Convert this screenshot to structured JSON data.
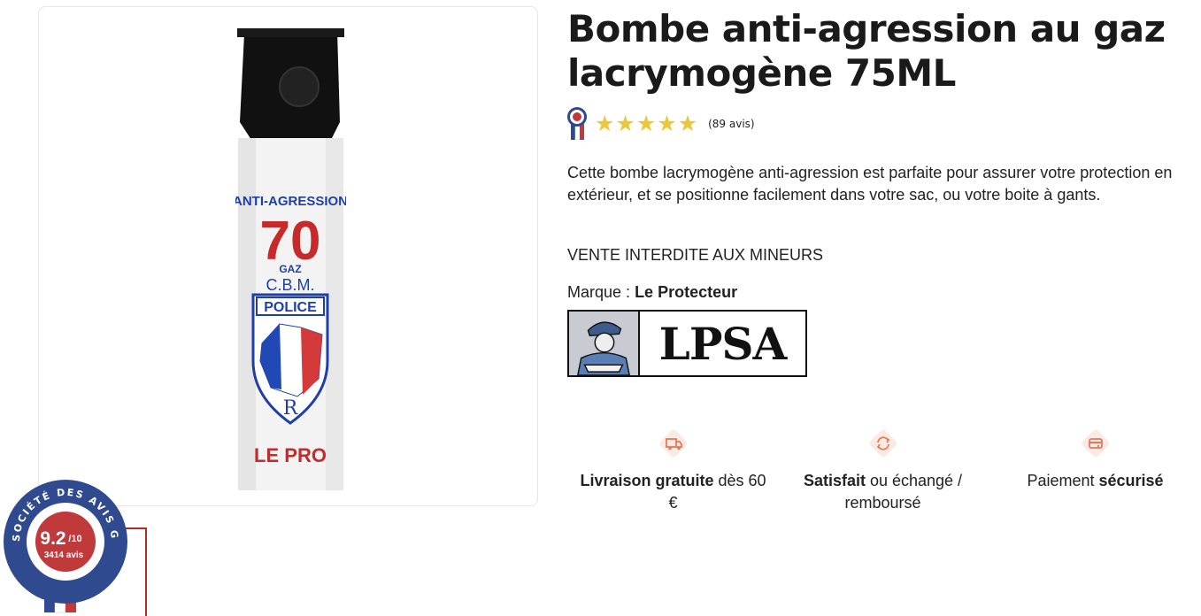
{
  "product": {
    "title": "Bombe anti-agression au gaz lacrymogène 75ML",
    "image_alt": "Spray anti-agression 70 gaz CBM Police Le Pro",
    "can_labels": {
      "line1": "ANTI-AGRESSION",
      "line2": "70",
      "line3": "GAZ",
      "line4": "C.B.M.",
      "line5": "POLICE",
      "line6": "LE PRO"
    },
    "rating": {
      "stars": 5,
      "review_count": "(89 avis)"
    },
    "description": "Cette bombe lacrymogène anti-agression est parfaite pour assurer votre protection en extérieur, et se positionne facilement dans votre sac, ou votre boite à gants.",
    "warning": "VENTE INTERDITE AUX MINEURS",
    "brand_label": "Marque :",
    "brand_name": "Le Protecteur",
    "brand_logo_text": "LPSA"
  },
  "features": [
    {
      "icon": "truck-icon",
      "bold": "Livraison gratuite",
      "rest": " dès 60 €"
    },
    {
      "icon": "refresh-icon",
      "bold": "Satisfait",
      "rest": " ou échangé / remboursé"
    },
    {
      "icon": "card-icon",
      "rest_before": "Paiement ",
      "bold": "sécurisé"
    }
  ],
  "badge": {
    "arc_text": "SOCIÉTÉ DES AVIS GARANTIS",
    "score": "9.2",
    "score_suffix": "/10",
    "reviews": "3414 avis"
  },
  "colors": {
    "star": "#ebc73a",
    "icon_accent": "#e07b5a",
    "badge_blue": "#2f4a8f",
    "badge_red": "#c0393b"
  }
}
